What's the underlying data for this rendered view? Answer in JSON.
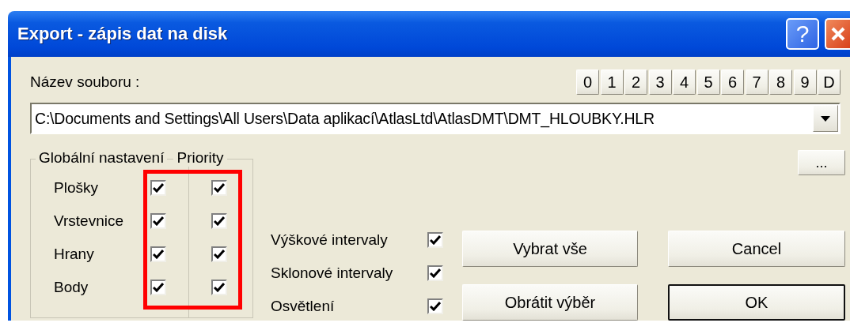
{
  "window": {
    "title": "Export - zápis dat na disk",
    "help_button": "?"
  },
  "file": {
    "label": "Název souboru :",
    "value": "C:\\Documents and Settings\\All Users\\Data aplikací\\AtlasLtd\\AtlasDMT\\DMT_HLOUBKY.HLR"
  },
  "slot_buttons": [
    "0",
    "1",
    "2",
    "3",
    "4",
    "5",
    "6",
    "7",
    "8",
    "9",
    "D"
  ],
  "browse_button": "...",
  "layers": {
    "columns": [
      "Globální nastavení",
      "Priority"
    ],
    "rows": [
      {
        "label": "Plošky",
        "global": true,
        "priority": true
      },
      {
        "label": "Vrstevnice",
        "global": true,
        "priority": true
      },
      {
        "label": "Hrany",
        "global": true,
        "priority": true
      },
      {
        "label": "Body",
        "global": true,
        "priority": true
      }
    ]
  },
  "options": [
    {
      "label": "Výškové intervaly",
      "checked": true
    },
    {
      "label": "Sklonové intervaly",
      "checked": true
    },
    {
      "label": "Osvětlení",
      "checked": true
    }
  ],
  "buttons": [
    {
      "label": "Vybrat vše",
      "default": false
    },
    {
      "label": "Cancel",
      "default": false
    },
    {
      "label": "Obrátit výběr",
      "default": false
    },
    {
      "label": "OK",
      "default": true
    }
  ]
}
